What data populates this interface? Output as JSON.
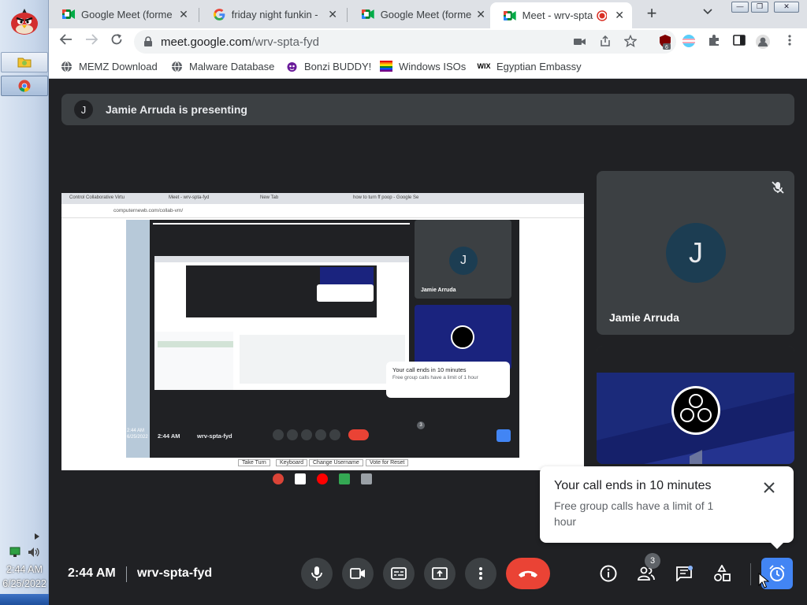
{
  "desktop": {
    "clock_time": "2:44 AM",
    "clock_date": "6/25/2022"
  },
  "tabs": [
    {
      "title": "Google Meet (forme",
      "icon": "meet-icon"
    },
    {
      "title": "friday night funkin -",
      "icon": "google-g-icon"
    },
    {
      "title": "Google Meet (forme",
      "icon": "meet-icon"
    },
    {
      "title": "Meet - wrv-spta",
      "icon": "meet-icon",
      "active": true
    }
  ],
  "toolbar": {
    "url_host": "meet.google.com",
    "url_path": "/wrv-spta-fyd"
  },
  "bookmarks": [
    {
      "label": "MEMZ Download",
      "icon": "globe-icon"
    },
    {
      "label": "Malware Database",
      "icon": "globe-icon"
    },
    {
      "label": "Bonzi BUDDY!",
      "icon": "bonzi-icon"
    },
    {
      "label": "Windows ISOs",
      "icon": "rainbow-flag-icon"
    },
    {
      "label": "Egyptian Embassy",
      "icon": "wix-icon",
      "icon_text": "WIX"
    }
  ],
  "meet": {
    "presenter_initial": "J",
    "presenting_text": "Jamie Arruda is presenting",
    "participant_name": "Jamie Arruda",
    "participant_initial": "J",
    "toast_title": "Your call ends in 10 minutes",
    "toast_body": "Free group calls have a limit of 1 hour",
    "time": "2:44 AM",
    "meeting_code": "wrv-spta-fyd",
    "people_count": "3"
  },
  "shared_screen": {
    "tabs": [
      "Control Collaborative Virtu",
      "Meet - wrv-spta-fyd",
      "New Tab",
      "how to turn ff poop - Google Se"
    ],
    "url": "computernewb.com/collab-vm/",
    "inner_participant_name": "Jamie Arruda",
    "inner_participant_initial": "J",
    "inner_toast_title": "Your call ends in 10 minutes",
    "inner_toast_body": "Free group calls have a limit of 1 hour",
    "inner_time": "2:44 AM",
    "inner_code": "wrv-spta-fyd",
    "inner_people_count": "3",
    "inner_desk_time": "2:44 AM",
    "inner_desk_date": "6/25/2022",
    "bottom_buttons": [
      "Take Turn",
      "Keyboard",
      "Change Username",
      "Vote for Reset"
    ]
  },
  "colors": {
    "meet_bg": "#202124",
    "tile_bg": "#3c4043",
    "end_call": "#ea4335",
    "accent_blue": "#4285f4"
  }
}
